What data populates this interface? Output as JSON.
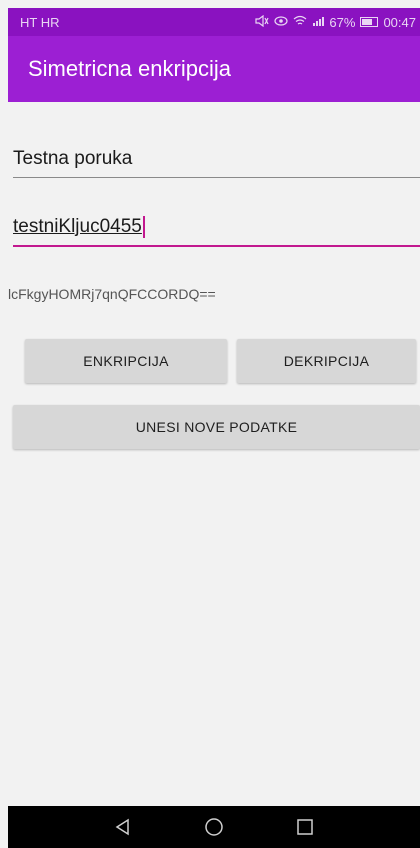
{
  "status_bar": {
    "carrier": "HT HR",
    "signal_text": "67%",
    "time": "00:47",
    "icons": [
      "mute-icon",
      "eye-icon",
      "wifi-icon",
      "signal-icon",
      "battery-icon"
    ]
  },
  "app_bar": {
    "title": "Simetricna enkripcija"
  },
  "form": {
    "message_value": "Testna poruka",
    "key_value": "testniKljuc0455",
    "output_text": "lcFkgyHOMRj7qnQFCCORDQ=="
  },
  "buttons": {
    "encrypt_label": "ENKRIPCIJA",
    "decrypt_label": "DEKRIPCIJA",
    "new_data_label": "UNESI NOVE PODATKE"
  },
  "nav": {
    "icons": [
      "back-icon",
      "home-icon",
      "recents-icon"
    ]
  },
  "colors": {
    "status_bar": "#8a12c0",
    "app_bar": "#9c1fd3",
    "accent": "#c2188f",
    "button": "#d7d7d7"
  }
}
